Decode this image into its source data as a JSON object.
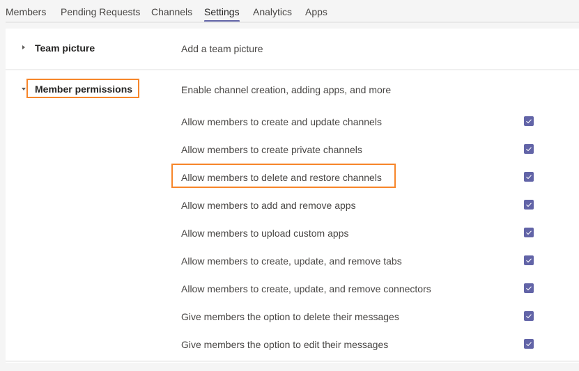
{
  "tabs": [
    {
      "label": "Members",
      "active": false
    },
    {
      "label": "Pending Requests",
      "active": false
    },
    {
      "label": "Channels",
      "active": false
    },
    {
      "label": "Settings",
      "active": true
    },
    {
      "label": "Analytics",
      "active": false
    },
    {
      "label": "Apps",
      "active": false
    }
  ],
  "sections": {
    "team_picture": {
      "title": "Team picture",
      "description": "Add a team picture",
      "expanded": false,
      "caret_icon": "caret-right-icon"
    },
    "member_permissions": {
      "title": "Member permissions",
      "description": "Enable channel creation, adding apps, and more",
      "expanded": true,
      "caret_icon": "caret-down-icon",
      "permissions": [
        {
          "label": "Allow members to create and update channels",
          "checked": true
        },
        {
          "label": "Allow members to create private channels",
          "checked": true
        },
        {
          "label": "Allow members to delete and restore channels",
          "checked": true
        },
        {
          "label": "Allow members to add and remove apps",
          "checked": true
        },
        {
          "label": "Allow members to upload custom apps",
          "checked": true
        },
        {
          "label": "Allow members to create, update, and remove tabs",
          "checked": true
        },
        {
          "label": "Allow members to create, update, and remove connectors",
          "checked": true
        },
        {
          "label": "Give members the option to delete their messages",
          "checked": true
        },
        {
          "label": "Give members the option to edit their messages",
          "checked": true
        }
      ]
    }
  },
  "colors": {
    "accent": "#6264a7",
    "highlight": "#f7862a"
  }
}
